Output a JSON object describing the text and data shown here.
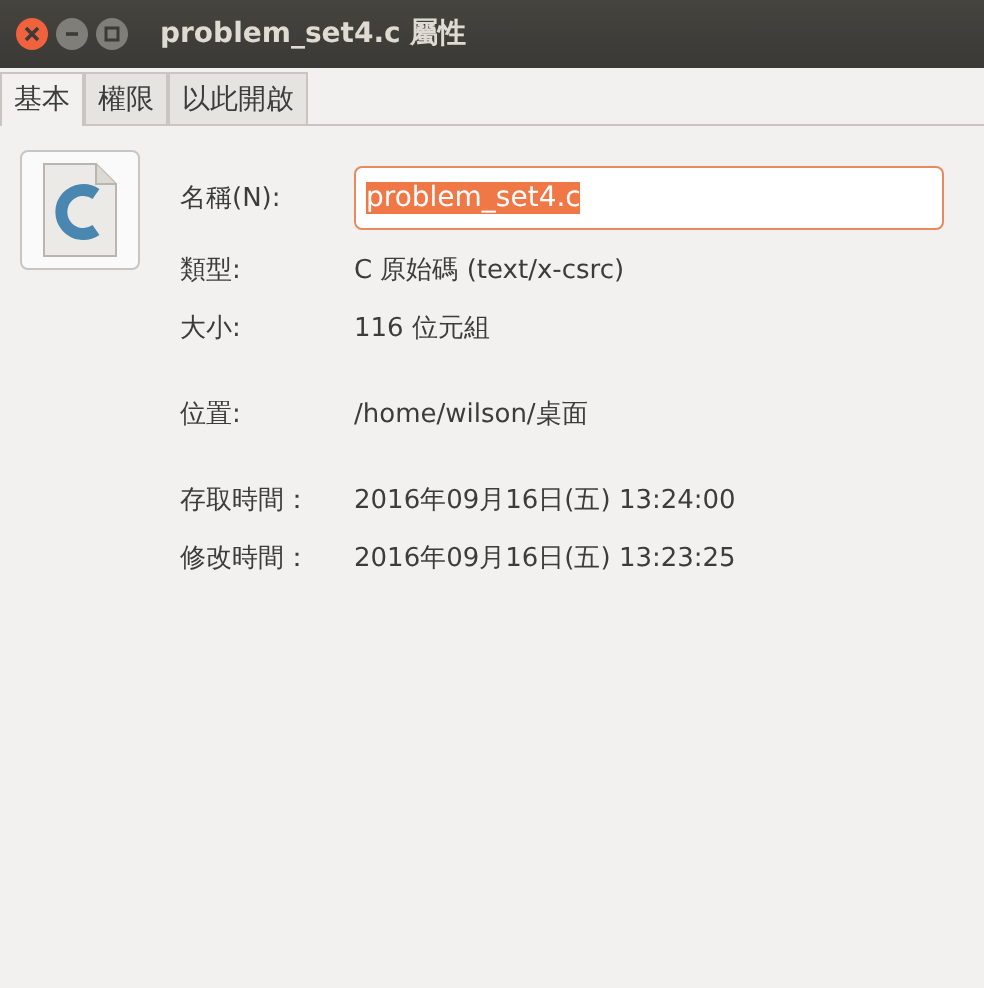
{
  "window": {
    "title": "problem_set4.c 屬性"
  },
  "tabs": [
    {
      "label": "基本",
      "selected": true
    },
    {
      "label": "權限",
      "selected": false
    },
    {
      "label": "以此開啟",
      "selected": false
    }
  ],
  "sections": [
    [
      {
        "label": "名稱(N):",
        "kind": "field",
        "value": "problem_set4.c"
      },
      {
        "label": "類型:",
        "kind": "text",
        "value": "C 原始碼 (text/x-csrc)"
      },
      {
        "label": "大小:",
        "kind": "text",
        "value": "116 位元組"
      }
    ],
    [
      {
        "label": "位置:",
        "kind": "text",
        "value": "/home/wilson/桌面"
      }
    ],
    [
      {
        "label": "存取時間：",
        "kind": "text",
        "value": "2016年09月16日(五) 13:24:00"
      },
      {
        "label": "修改時間：",
        "kind": "text",
        "value": "2016年09月16日(五) 13:23:25"
      }
    ]
  ]
}
